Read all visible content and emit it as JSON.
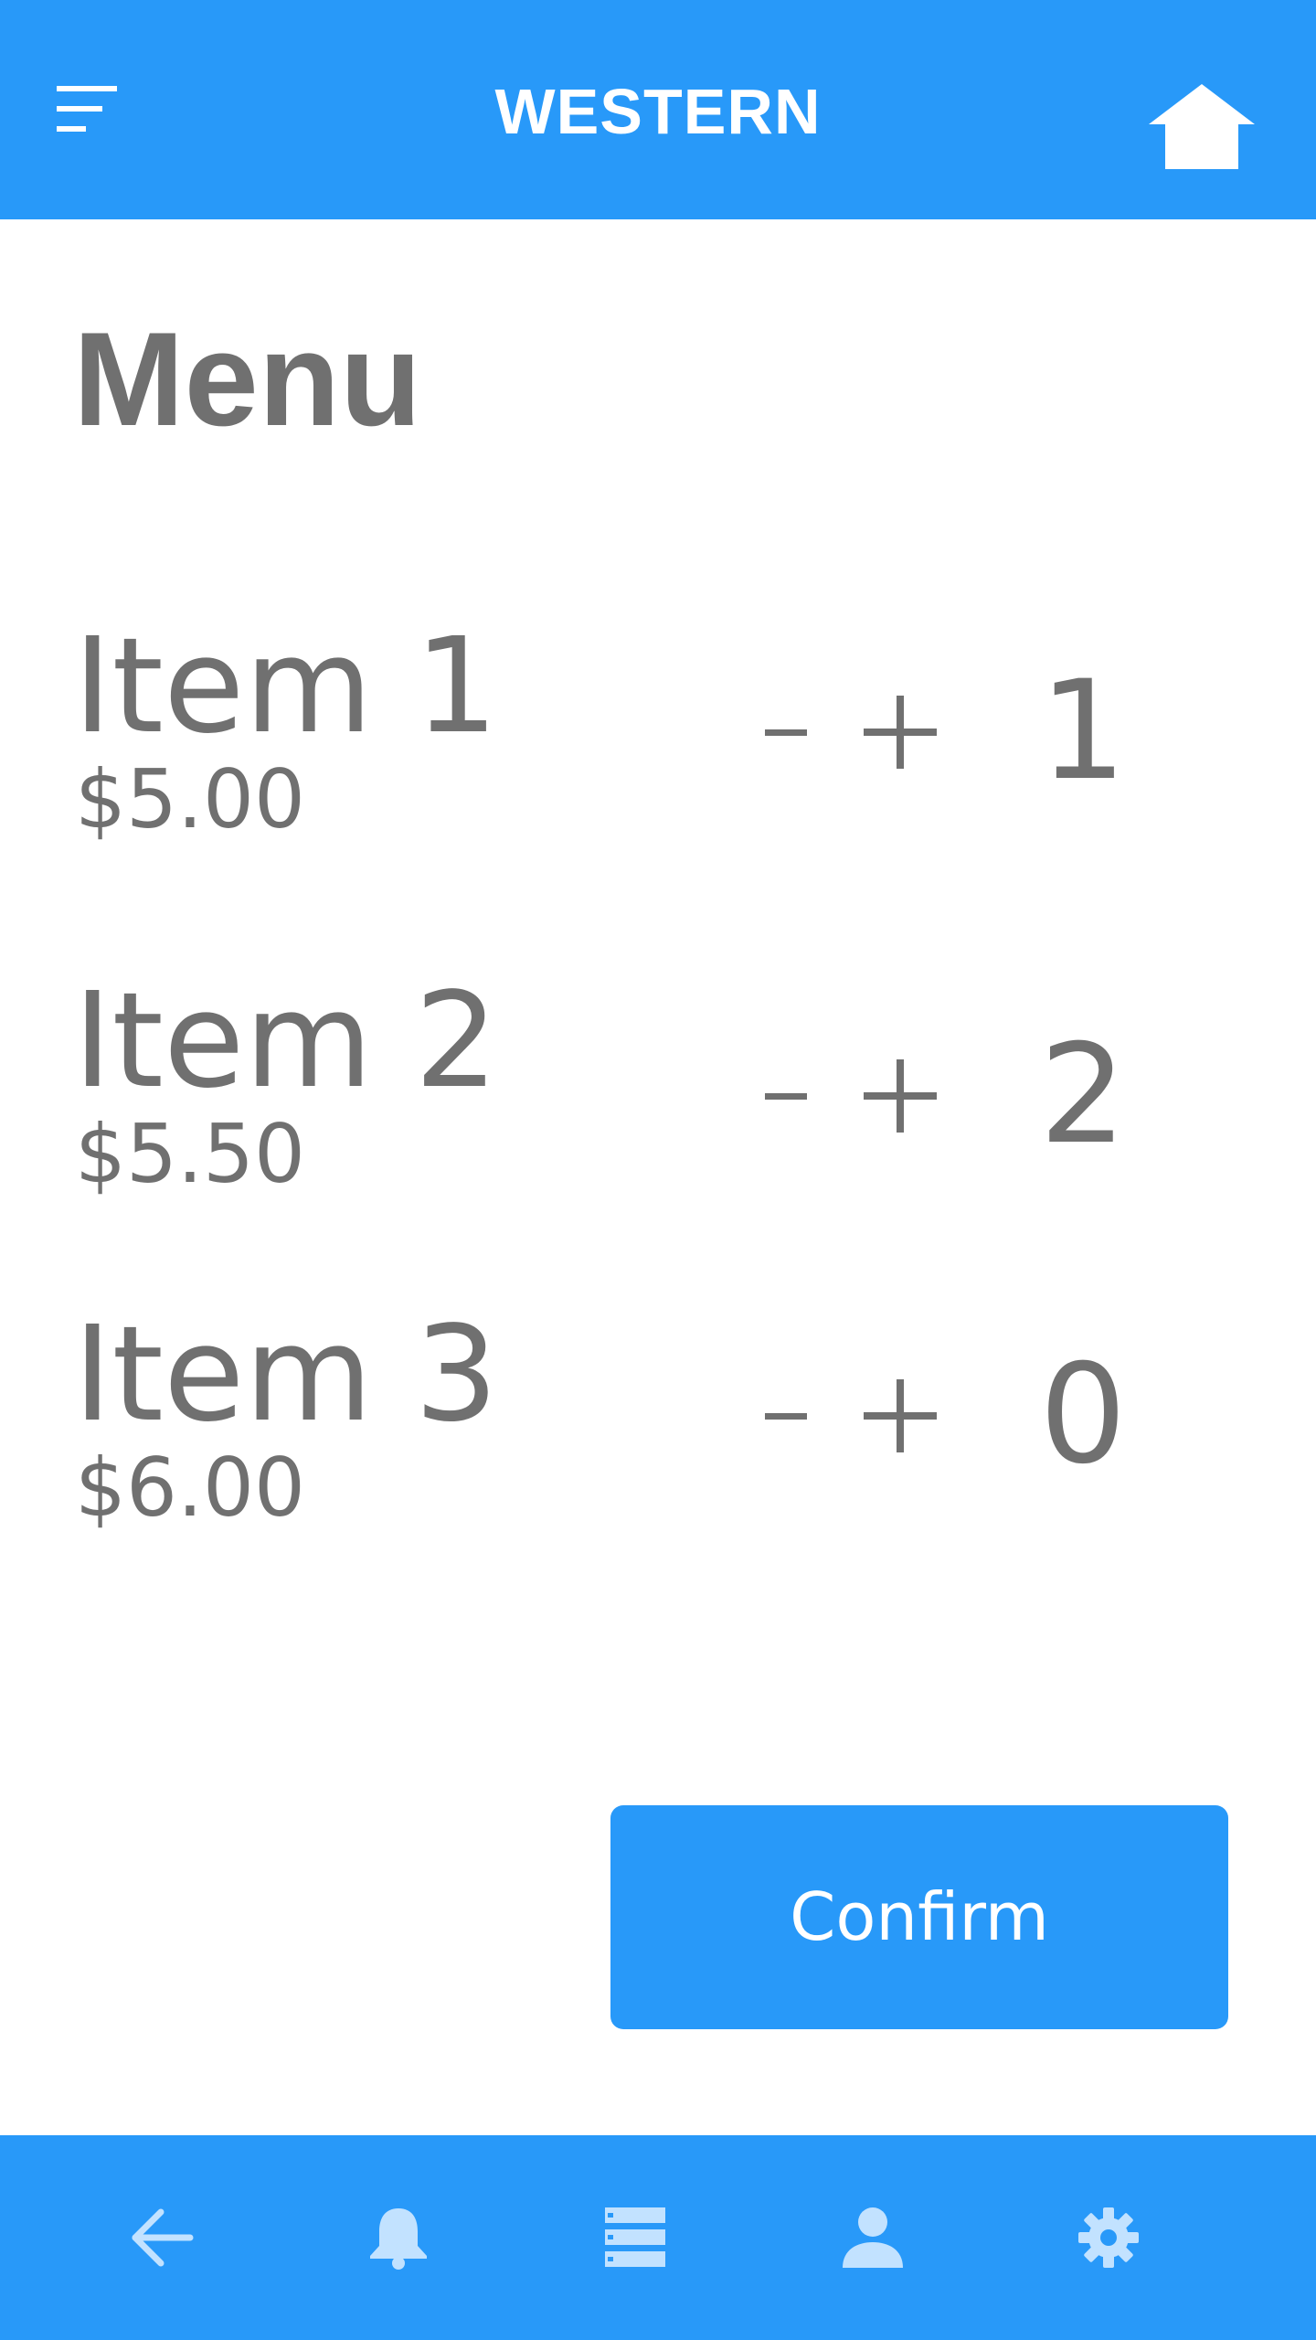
{
  "header": {
    "title": "WESTERN",
    "menu_icon": "hamburger-menu-icon",
    "home_icon": "home-icon"
  },
  "page": {
    "title": "Menu"
  },
  "items": [
    {
      "name": "Item 1",
      "price": "$5.00",
      "quantity": "1",
      "decrement_label": "-",
      "increment_label": "+"
    },
    {
      "name": "Item 2",
      "price": "$5.50",
      "quantity": "2",
      "decrement_label": "-",
      "increment_label": "+"
    },
    {
      "name": "Item 3",
      "price": "$6.00",
      "quantity": "0",
      "decrement_label": "-",
      "increment_label": "+"
    }
  ],
  "confirm": {
    "label": "Confirm"
  },
  "bottom_nav": {
    "items": [
      {
        "icon": "back-arrow-icon"
      },
      {
        "icon": "bell-icon"
      },
      {
        "icon": "list-icon"
      },
      {
        "icon": "user-icon"
      },
      {
        "icon": "gear-icon"
      }
    ]
  },
  "colors": {
    "primary": "#2899f9",
    "text": "#707070",
    "nav_icon": "#c2e2ff",
    "on_primary": "#ffffff"
  }
}
